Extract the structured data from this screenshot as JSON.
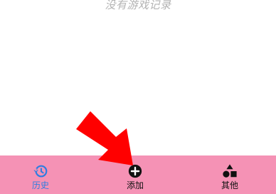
{
  "empty_state": {
    "text": "没有游戏记录"
  },
  "tabbar": {
    "background": "#f592b5",
    "active_color": "#2f7de1",
    "tabs": [
      {
        "label": "历史",
        "icon": "history-icon",
        "active": true
      },
      {
        "label": "添加",
        "icon": "add-circle-icon",
        "active": false
      },
      {
        "label": "其他",
        "icon": "shapes-icon",
        "active": false
      }
    ]
  },
  "annotation": {
    "icon": "red-arrow-pointer",
    "color": "#ff0000"
  }
}
